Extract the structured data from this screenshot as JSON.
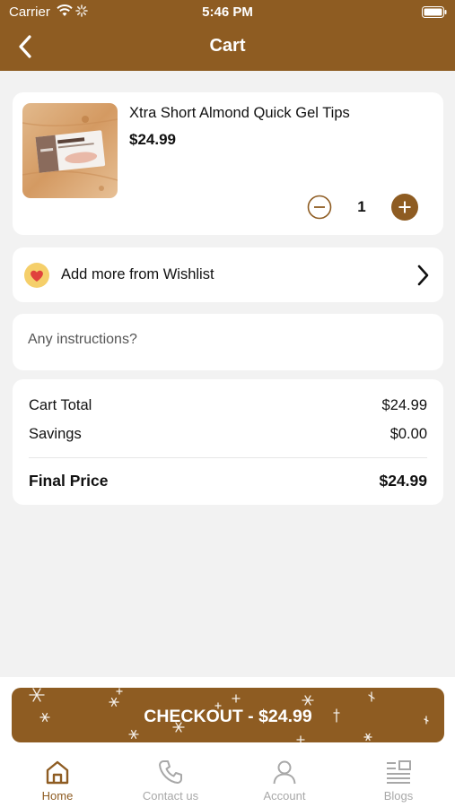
{
  "status_bar": {
    "carrier": "Carrier",
    "time": "5:46 PM"
  },
  "header": {
    "title": "Cart"
  },
  "cart_item": {
    "name": "Xtra Short Almond Quick Gel Tips",
    "price": "$24.99",
    "quantity": "1",
    "image_icon": "nail-tips-product-photo"
  },
  "wishlist": {
    "label": "Add more from Wishlist"
  },
  "instructions": {
    "placeholder": "Any instructions?"
  },
  "summary": {
    "cart_total_label": "Cart Total",
    "cart_total_value": "$24.99",
    "savings_label": "Savings",
    "savings_value": "$0.00",
    "final_price_label": "Final Price",
    "final_price_value": "$24.99"
  },
  "checkout": {
    "label": "CHECKOUT - $24.99"
  },
  "tabs": [
    {
      "label": "Home",
      "icon": "home-icon",
      "active": true
    },
    {
      "label": "Contact us",
      "icon": "phone-icon",
      "active": false
    },
    {
      "label": "Account",
      "icon": "user-icon",
      "active": false
    },
    {
      "label": "Blogs",
      "icon": "blog-icon",
      "active": false
    }
  ],
  "colors": {
    "brand": "#8e5c22",
    "background": "#f2f2f2",
    "card": "#ffffff",
    "tab_inactive": "#a8a8a8",
    "heart": "#e0423d",
    "heart_bg": "#f5cf6a"
  }
}
